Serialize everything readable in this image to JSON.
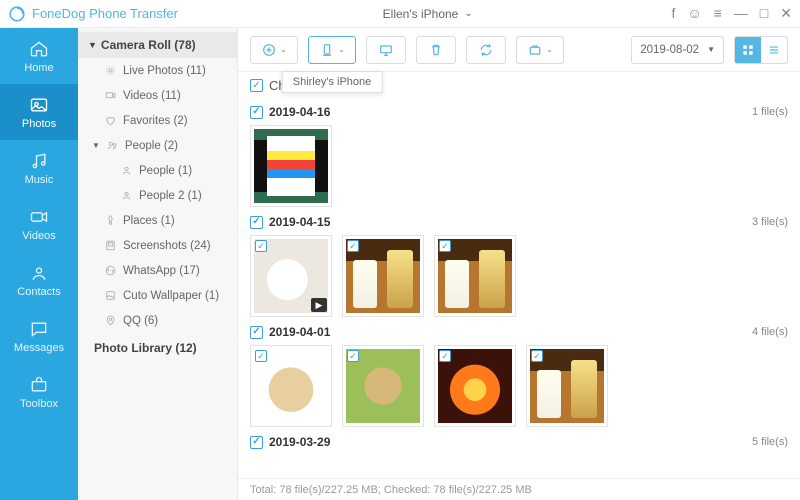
{
  "app": {
    "title": "FoneDog Phone Transfer"
  },
  "device": {
    "name": "Ellen's iPhone"
  },
  "nav": [
    {
      "id": "home",
      "label": "Home"
    },
    {
      "id": "photos",
      "label": "Photos"
    },
    {
      "id": "music",
      "label": "Music"
    },
    {
      "id": "videos",
      "label": "Videos"
    },
    {
      "id": "contacts",
      "label": "Contacts"
    },
    {
      "id": "messages",
      "label": "Messages"
    },
    {
      "id": "toolbox",
      "label": "Toolbox"
    }
  ],
  "sidebar": {
    "camera_roll": {
      "label": "Camera Roll (78)"
    },
    "items": [
      {
        "label": "Live Photos (11)"
      },
      {
        "label": "Videos (11)"
      },
      {
        "label": "Favorites (2)"
      },
      {
        "label": "People (2)",
        "expandable": true
      },
      {
        "label": "People (1)",
        "sub": true
      },
      {
        "label": "People 2 (1)",
        "sub": true
      },
      {
        "label": "Places (1)"
      },
      {
        "label": "Screenshots (24)"
      },
      {
        "label": "WhatsApp (17)"
      },
      {
        "label": "Cuto Wallpaper (1)"
      },
      {
        "label": "QQ (6)"
      }
    ],
    "library": {
      "label": "Photo Library (12)"
    }
  },
  "toolbar": {
    "tooltip": "Shirley's iPhone",
    "date": "2019-08-02"
  },
  "checkall": {
    "label": "Check All(78)"
  },
  "groups": [
    {
      "date": "2019-04-16",
      "count_label": "1 file(s)",
      "thumbs": [
        "phone"
      ]
    },
    {
      "date": "2019-04-15",
      "count_label": "3 file(s)",
      "thumbs": [
        "mug_vid",
        "drinks",
        "drinks"
      ]
    },
    {
      "date": "2019-04-01",
      "count_label": "4 file(s)",
      "thumbs": [
        "pup1",
        "pup2",
        "fire",
        "drinks"
      ]
    },
    {
      "date": "2019-03-29",
      "count_label": "5 file(s)",
      "thumbs": []
    }
  ],
  "status": {
    "text": "Total: 78 file(s)/227.25 MB; Checked: 78 file(s)/227.25 MB"
  }
}
